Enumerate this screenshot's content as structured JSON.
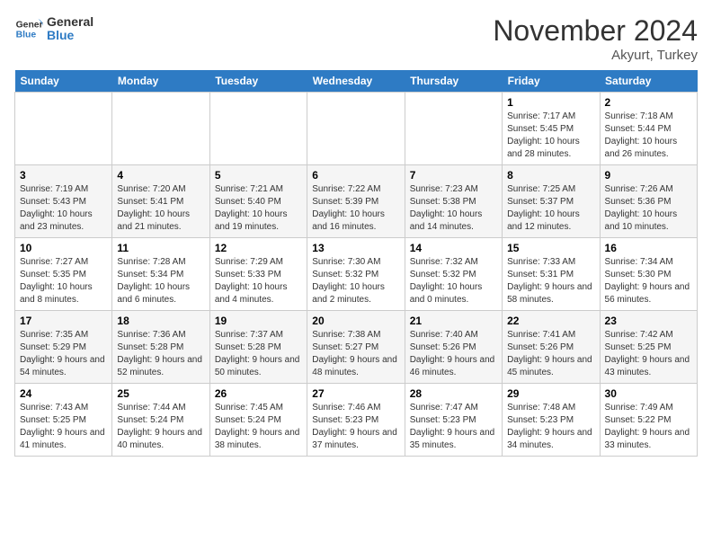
{
  "header": {
    "logo_line1": "General",
    "logo_line2": "Blue",
    "month_year": "November 2024",
    "location": "Akyurt, Turkey"
  },
  "weekdays": [
    "Sunday",
    "Monday",
    "Tuesday",
    "Wednesday",
    "Thursday",
    "Friday",
    "Saturday"
  ],
  "weeks": [
    [
      {
        "day": "",
        "info": ""
      },
      {
        "day": "",
        "info": ""
      },
      {
        "day": "",
        "info": ""
      },
      {
        "day": "",
        "info": ""
      },
      {
        "day": "",
        "info": ""
      },
      {
        "day": "1",
        "info": "Sunrise: 7:17 AM\nSunset: 5:45 PM\nDaylight: 10 hours and 28 minutes."
      },
      {
        "day": "2",
        "info": "Sunrise: 7:18 AM\nSunset: 5:44 PM\nDaylight: 10 hours and 26 minutes."
      }
    ],
    [
      {
        "day": "3",
        "info": "Sunrise: 7:19 AM\nSunset: 5:43 PM\nDaylight: 10 hours and 23 minutes."
      },
      {
        "day": "4",
        "info": "Sunrise: 7:20 AM\nSunset: 5:41 PM\nDaylight: 10 hours and 21 minutes."
      },
      {
        "day": "5",
        "info": "Sunrise: 7:21 AM\nSunset: 5:40 PM\nDaylight: 10 hours and 19 minutes."
      },
      {
        "day": "6",
        "info": "Sunrise: 7:22 AM\nSunset: 5:39 PM\nDaylight: 10 hours and 16 minutes."
      },
      {
        "day": "7",
        "info": "Sunrise: 7:23 AM\nSunset: 5:38 PM\nDaylight: 10 hours and 14 minutes."
      },
      {
        "day": "8",
        "info": "Sunrise: 7:25 AM\nSunset: 5:37 PM\nDaylight: 10 hours and 12 minutes."
      },
      {
        "day": "9",
        "info": "Sunrise: 7:26 AM\nSunset: 5:36 PM\nDaylight: 10 hours and 10 minutes."
      }
    ],
    [
      {
        "day": "10",
        "info": "Sunrise: 7:27 AM\nSunset: 5:35 PM\nDaylight: 10 hours and 8 minutes."
      },
      {
        "day": "11",
        "info": "Sunrise: 7:28 AM\nSunset: 5:34 PM\nDaylight: 10 hours and 6 minutes."
      },
      {
        "day": "12",
        "info": "Sunrise: 7:29 AM\nSunset: 5:33 PM\nDaylight: 10 hours and 4 minutes."
      },
      {
        "day": "13",
        "info": "Sunrise: 7:30 AM\nSunset: 5:32 PM\nDaylight: 10 hours and 2 minutes."
      },
      {
        "day": "14",
        "info": "Sunrise: 7:32 AM\nSunset: 5:32 PM\nDaylight: 10 hours and 0 minutes."
      },
      {
        "day": "15",
        "info": "Sunrise: 7:33 AM\nSunset: 5:31 PM\nDaylight: 9 hours and 58 minutes."
      },
      {
        "day": "16",
        "info": "Sunrise: 7:34 AM\nSunset: 5:30 PM\nDaylight: 9 hours and 56 minutes."
      }
    ],
    [
      {
        "day": "17",
        "info": "Sunrise: 7:35 AM\nSunset: 5:29 PM\nDaylight: 9 hours and 54 minutes."
      },
      {
        "day": "18",
        "info": "Sunrise: 7:36 AM\nSunset: 5:28 PM\nDaylight: 9 hours and 52 minutes."
      },
      {
        "day": "19",
        "info": "Sunrise: 7:37 AM\nSunset: 5:28 PM\nDaylight: 9 hours and 50 minutes."
      },
      {
        "day": "20",
        "info": "Sunrise: 7:38 AM\nSunset: 5:27 PM\nDaylight: 9 hours and 48 minutes."
      },
      {
        "day": "21",
        "info": "Sunrise: 7:40 AM\nSunset: 5:26 PM\nDaylight: 9 hours and 46 minutes."
      },
      {
        "day": "22",
        "info": "Sunrise: 7:41 AM\nSunset: 5:26 PM\nDaylight: 9 hours and 45 minutes."
      },
      {
        "day": "23",
        "info": "Sunrise: 7:42 AM\nSunset: 5:25 PM\nDaylight: 9 hours and 43 minutes."
      }
    ],
    [
      {
        "day": "24",
        "info": "Sunrise: 7:43 AM\nSunset: 5:25 PM\nDaylight: 9 hours and 41 minutes."
      },
      {
        "day": "25",
        "info": "Sunrise: 7:44 AM\nSunset: 5:24 PM\nDaylight: 9 hours and 40 minutes."
      },
      {
        "day": "26",
        "info": "Sunrise: 7:45 AM\nSunset: 5:24 PM\nDaylight: 9 hours and 38 minutes."
      },
      {
        "day": "27",
        "info": "Sunrise: 7:46 AM\nSunset: 5:23 PM\nDaylight: 9 hours and 37 minutes."
      },
      {
        "day": "28",
        "info": "Sunrise: 7:47 AM\nSunset: 5:23 PM\nDaylight: 9 hours and 35 minutes."
      },
      {
        "day": "29",
        "info": "Sunrise: 7:48 AM\nSunset: 5:23 PM\nDaylight: 9 hours and 34 minutes."
      },
      {
        "day": "30",
        "info": "Sunrise: 7:49 AM\nSunset: 5:22 PM\nDaylight: 9 hours and 33 minutes."
      }
    ]
  ]
}
